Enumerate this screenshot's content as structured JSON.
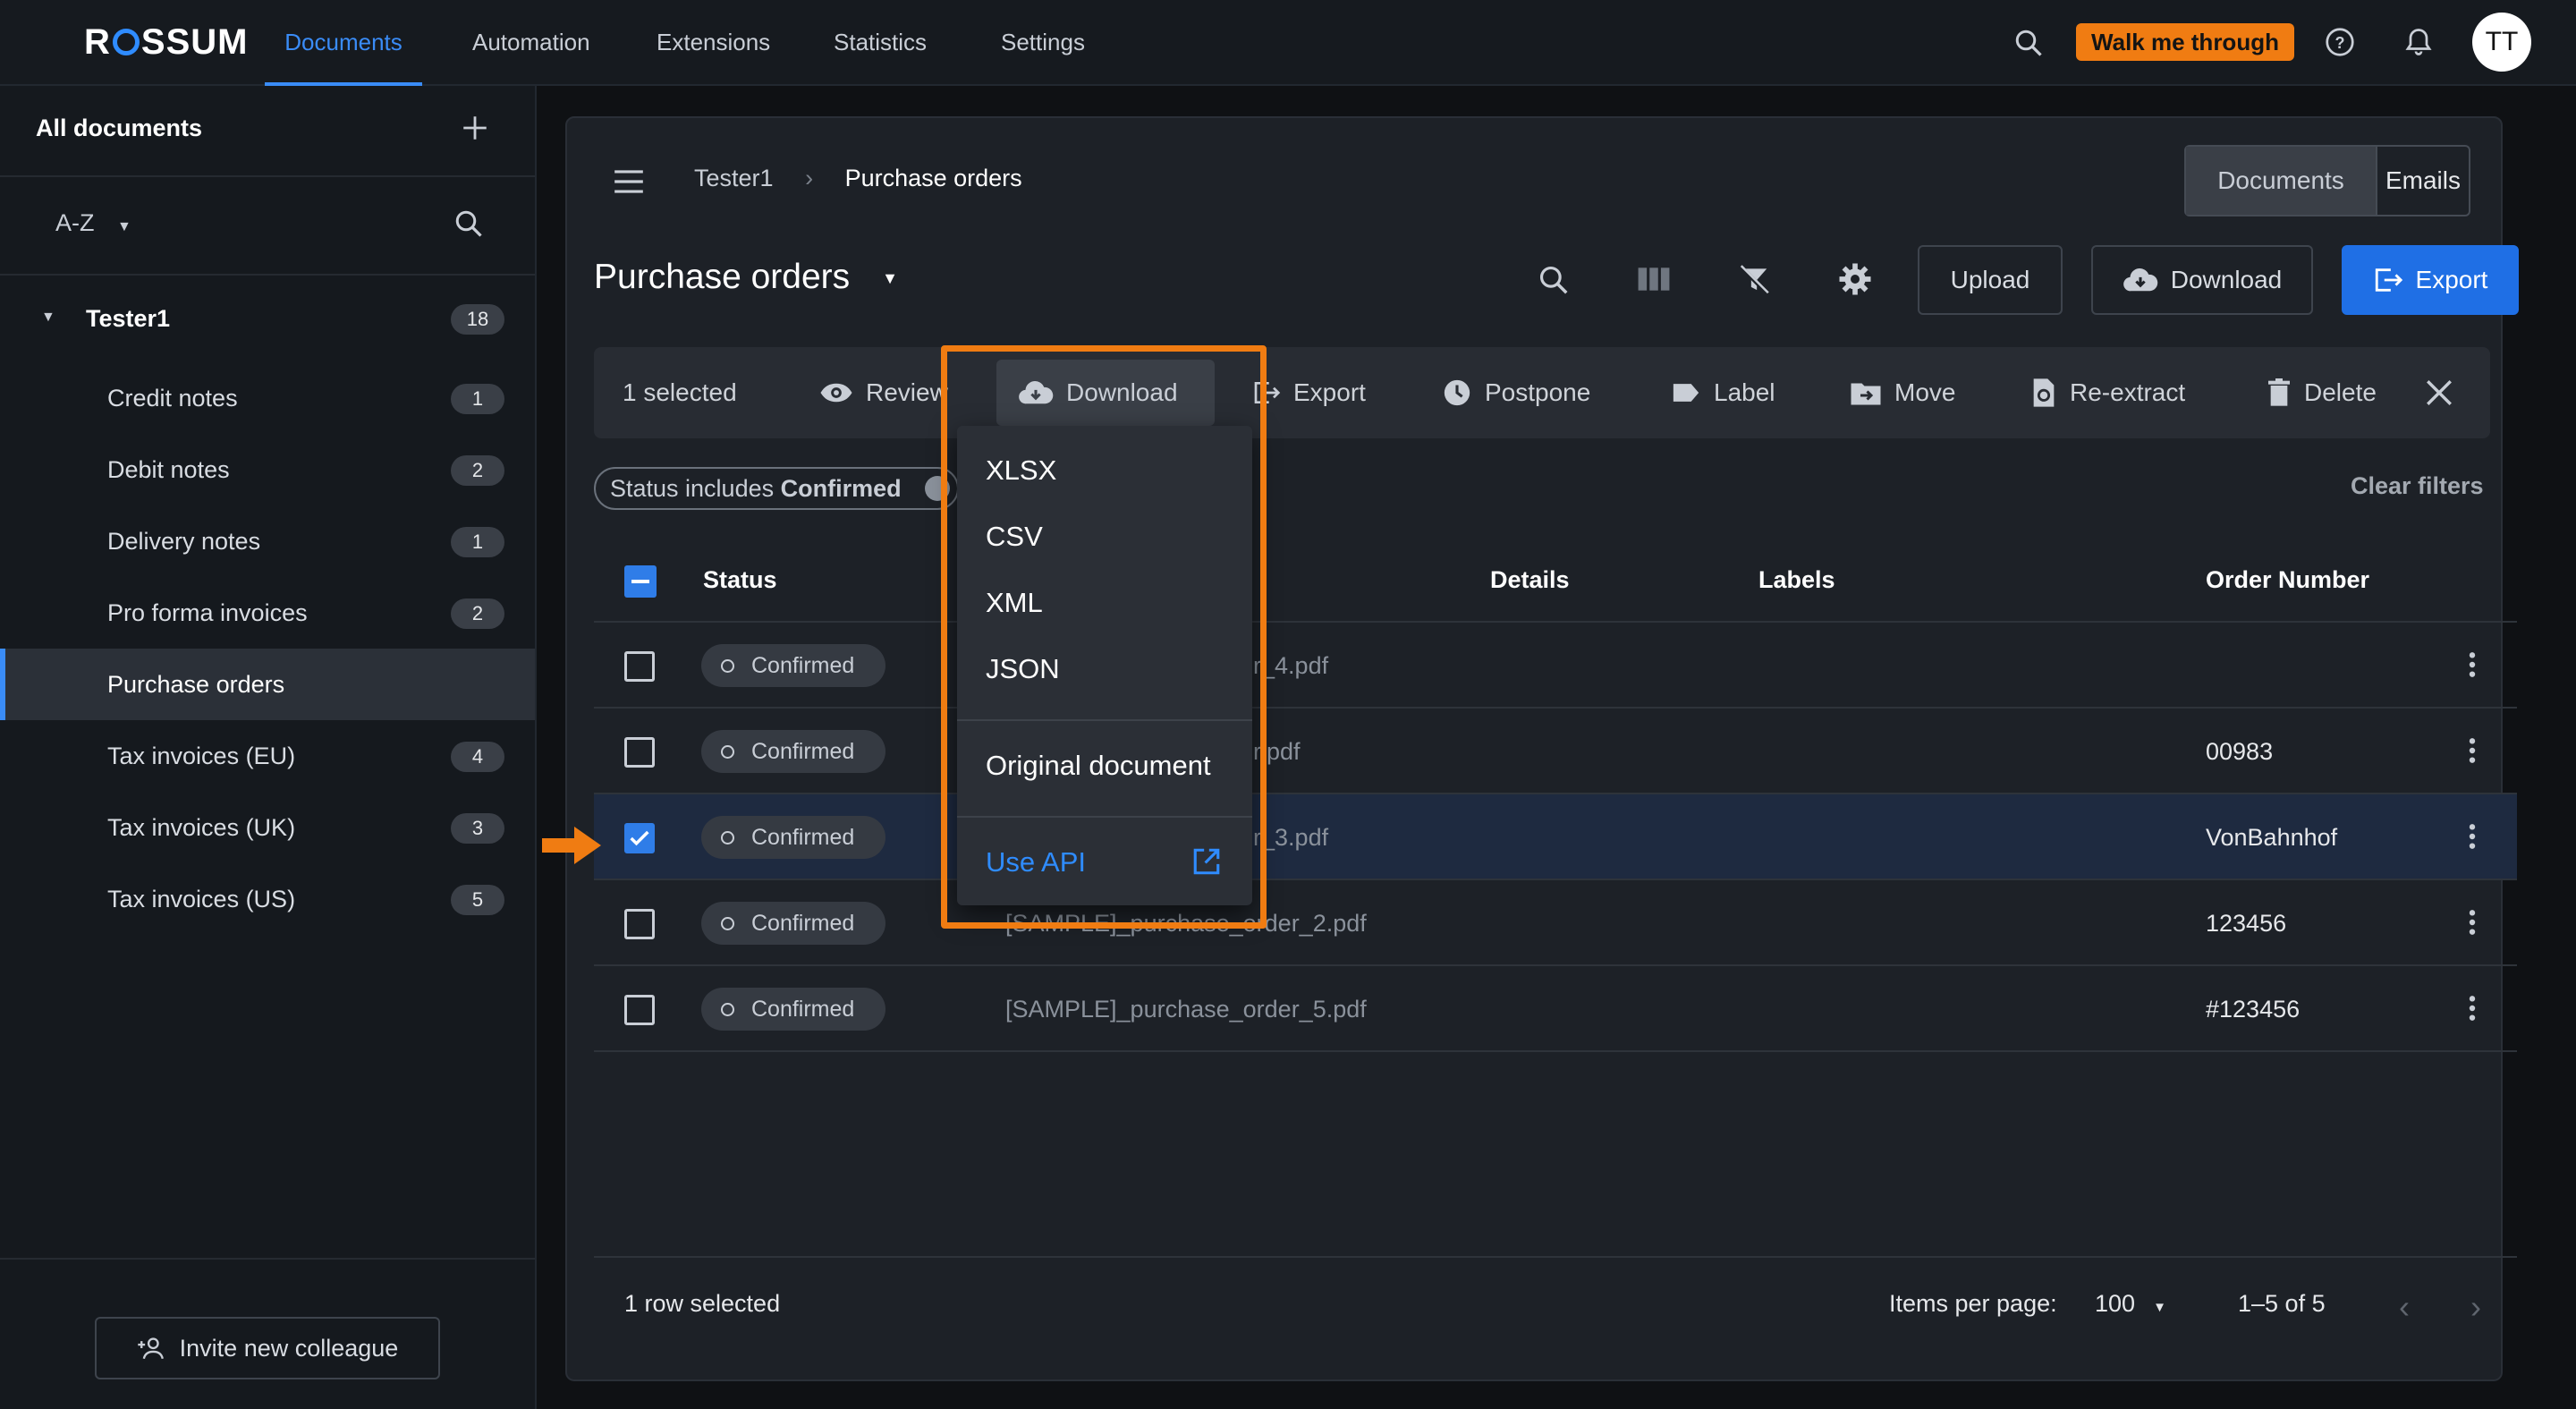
{
  "app": {
    "logo": "ROSSUM",
    "walk_me": "Walk me through",
    "avatar_initials": "TT"
  },
  "nav": {
    "tabs": [
      "Documents",
      "Automation",
      "Extensions",
      "Statistics",
      "Settings"
    ],
    "active": "Documents"
  },
  "sidebar": {
    "header": "All documents",
    "sort_label": "A-Z",
    "group": {
      "name": "Tester1",
      "count": "18"
    },
    "queues": [
      {
        "label": "Credit notes",
        "count": "1"
      },
      {
        "label": "Debit notes",
        "count": "2"
      },
      {
        "label": "Delivery notes",
        "count": "1"
      },
      {
        "label": "Pro forma invoices",
        "count": "2"
      },
      {
        "label": "Purchase orders",
        "count": "",
        "active": true
      },
      {
        "label": "Tax invoices (EU)",
        "count": "4"
      },
      {
        "label": "Tax invoices (UK)",
        "count": "3"
      },
      {
        "label": "Tax invoices (US)",
        "count": "5"
      }
    ],
    "invite_label": "Invite new colleague"
  },
  "breadcrumb": {
    "parent": "Tester1",
    "current": "Purchase orders"
  },
  "view_toggle": {
    "documents": "Documents",
    "emails": "Emails"
  },
  "page_title": "Purchase orders",
  "actions": {
    "upload": "Upload",
    "download": "Download",
    "export": "Export"
  },
  "bulk": {
    "selected": "1 selected",
    "review": "Review",
    "download": "Download",
    "export": "Export",
    "postpone": "Postpone",
    "label": "Label",
    "move": "Move",
    "reextract": "Re-extract",
    "delete": "Delete"
  },
  "filter": {
    "chip_prefix": "Status includes",
    "chip_value": "Confirmed",
    "clear": "Clear filters"
  },
  "table": {
    "columns": {
      "status": "Status",
      "details": "Details",
      "labels": "Labels",
      "order_number": "Order Number"
    },
    "rows": [
      {
        "status": "Confirmed",
        "file_visible": "rder_4.pdf",
        "order": "",
        "checked": false
      },
      {
        "status": "Confirmed",
        "file_visible": "rder.pdf",
        "order": "00983",
        "checked": false
      },
      {
        "status": "Confirmed",
        "file_visible": "rder_3.pdf",
        "order": "VonBahnhof",
        "checked": true
      },
      {
        "status": "Confirmed",
        "file_visible": "[SAMPLE]_purchase_order_2.pdf",
        "order": "123456",
        "checked": false
      },
      {
        "status": "Confirmed",
        "file_visible": "[SAMPLE]_purchase_order_5.pdf",
        "order": "#123456",
        "checked": false
      }
    ]
  },
  "dropdown": {
    "items": [
      "XLSX",
      "CSV",
      "XML",
      "JSON"
    ],
    "original": "Original document",
    "api": "Use API"
  },
  "footer": {
    "selected": "1 row selected",
    "items_per_page_label": "Items per page:",
    "items_per_page": "100",
    "range": "1–5 of 5"
  },
  "colors": {
    "accent": "#3a8cf7",
    "highlight": "#f07c12",
    "panel": "#1d2127",
    "selected_row": "#1e2a40"
  },
  "icons": [
    "search-icon",
    "help-icon",
    "bell-icon",
    "plus-icon",
    "menu-icon",
    "columns-icon",
    "filter-off-icon",
    "gear-icon",
    "cloud-download-icon",
    "export-icon",
    "eye-icon",
    "clock-icon",
    "tag-icon",
    "folder-move-icon",
    "reextract-icon",
    "trash-icon",
    "close-icon",
    "kebab-icon",
    "external-link-icon",
    "person-add-icon",
    "arrow-right-icon",
    "chevron-left-icon",
    "chevron-right-icon"
  ]
}
